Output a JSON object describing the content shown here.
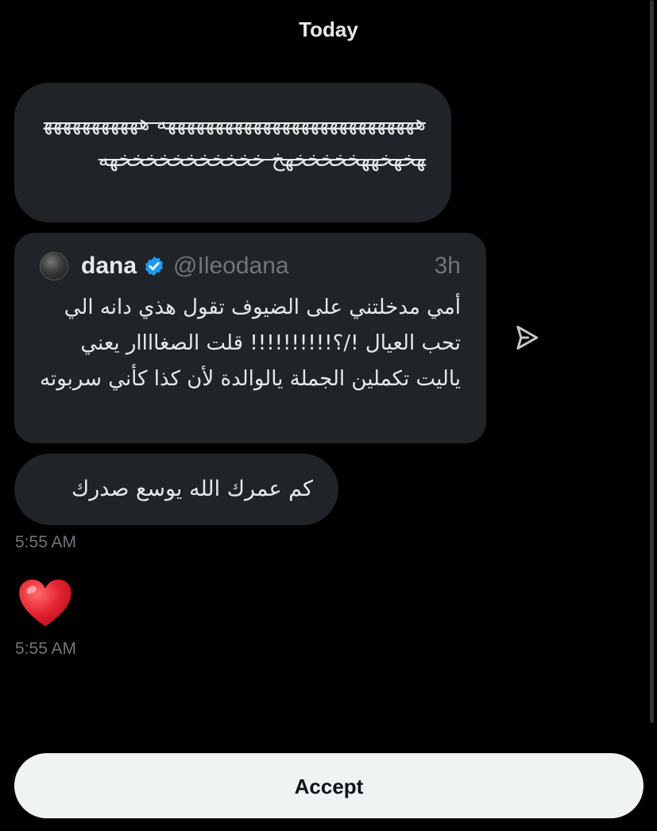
{
  "conversation": {
    "date_header": "Today"
  },
  "messages": [
    {
      "text": "هههههههههههههههههههههههههههه ههههههههههههخهخههخخخخخهخ خخخخخخخخخخخهه"
    },
    {
      "quote": {
        "name": "dana",
        "handle": "@Ileodana",
        "time": "3h",
        "text": "أمي مدخلتني على الضيوف تقول هذي دانه الي تحب العيال !/؟!!!!!!!!!! قلت الصغاااار يعني ياليت تكملين الجملة يالوالدة لأن كذا كأني سربوته",
        "verified_color": "#1d9bf0"
      }
    },
    {
      "text": "كم عمرك الله يوسع صدرك",
      "timestamp": "5:55 AM"
    },
    {
      "reaction_icon": "red-heart-icon",
      "timestamp": "5:55 AM"
    }
  ],
  "actions": {
    "accept_label": "Accept"
  },
  "colors": {
    "background": "#000000",
    "bubble": "#202327",
    "muted_text": "#71767b",
    "button": "#eff3f4"
  }
}
